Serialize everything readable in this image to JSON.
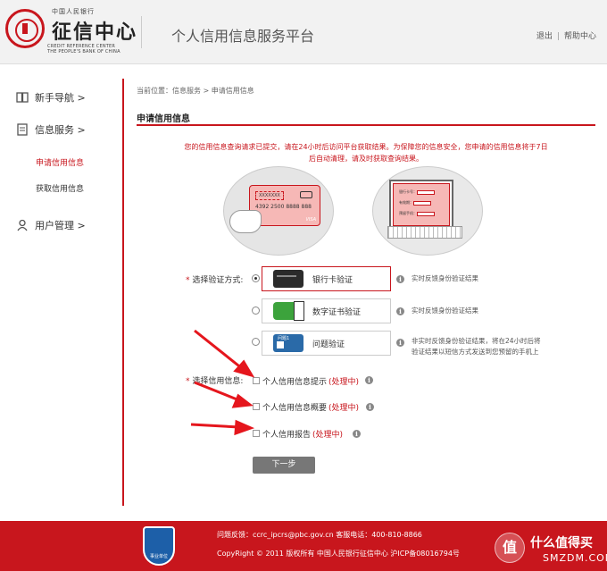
{
  "header": {
    "logo_top": "中国人民银行",
    "logo_main": "征信中心",
    "logo_en1": "CREDIT REFERENCE CENTER",
    "logo_en2": "THE PEOPLE'S BANK OF CHINA",
    "site_title": "个人信用信息服务平台",
    "logout": "退出",
    "separator": "|",
    "help": "帮助中心"
  },
  "sidebar": {
    "items": [
      {
        "label": "新手导航 >",
        "icon": "book-icon"
      },
      {
        "label": "信息服务 >",
        "icon": "document-icon"
      },
      {
        "label": "用户管理 >",
        "icon": "user-icon"
      }
    ],
    "sub_items": [
      {
        "label": "申请信用信息",
        "active": true
      },
      {
        "label": "获取信用信息",
        "active": false
      }
    ]
  },
  "main": {
    "breadcrumb": "当前位置：信息服务 > 申请信用信息",
    "section_title": "申请信用信息",
    "notice_line1": "您的信用信息查询请求已提交，请在24小时后访问平台获取结果。为保障您的信息安全，您申请的信用信息将于7日",
    "notice_line2": "后自动清理，请及时获取查询结果。",
    "illus_card": {
      "tag": "XXXXXXX",
      "number": "4392  2500  8888  888",
      "brand": "VISA",
      "chip": "银联"
    },
    "illus_form": {
      "row1": "银行卡号：",
      "row2": "有效期：",
      "row3": "预留手机："
    },
    "method_label": "选择验证方式:",
    "required_mark": "*",
    "methods": [
      {
        "label": "银行卡验证",
        "desc1": "实时反馈身份验证结果",
        "desc2": "",
        "selected": true
      },
      {
        "label": "数字证书验证",
        "desc1": "实时反馈身份验证结果",
        "desc2": "",
        "selected": false
      },
      {
        "label": "问题验证",
        "icon_text": "问题1",
        "desc1": "非实时反馈身份验证结果，将在24小时后将",
        "desc2": "验证结果以短信方式发送到您预留的手机上",
        "selected": false
      }
    ],
    "info_label": "选择信用信息:",
    "reports": [
      {
        "label": "个人信用信息提示",
        "status": "(处理中)"
      },
      {
        "label": "个人信用信息概要",
        "status": "(处理中)"
      },
      {
        "label": "个人信用报告",
        "status": "(处理中)"
      }
    ],
    "next_button": "下一步",
    "info_glyph": "i"
  },
  "footer": {
    "badge": "事业单位",
    "line1": "问题反馈：ccrc_ipcrs@pbc.gov.cn      客服电话：400-810-8866",
    "line2": "CopyRight © 2011    版权所有    中国人民银行征信中心    沪ICP备08016794号"
  },
  "watermark": {
    "glyph": "值",
    "text1": "什么值得买",
    "text2": "SMZDM.COM"
  },
  "colors": {
    "accent": "#c8161d",
    "button": "#777777",
    "badge": "#1d5fa8"
  }
}
